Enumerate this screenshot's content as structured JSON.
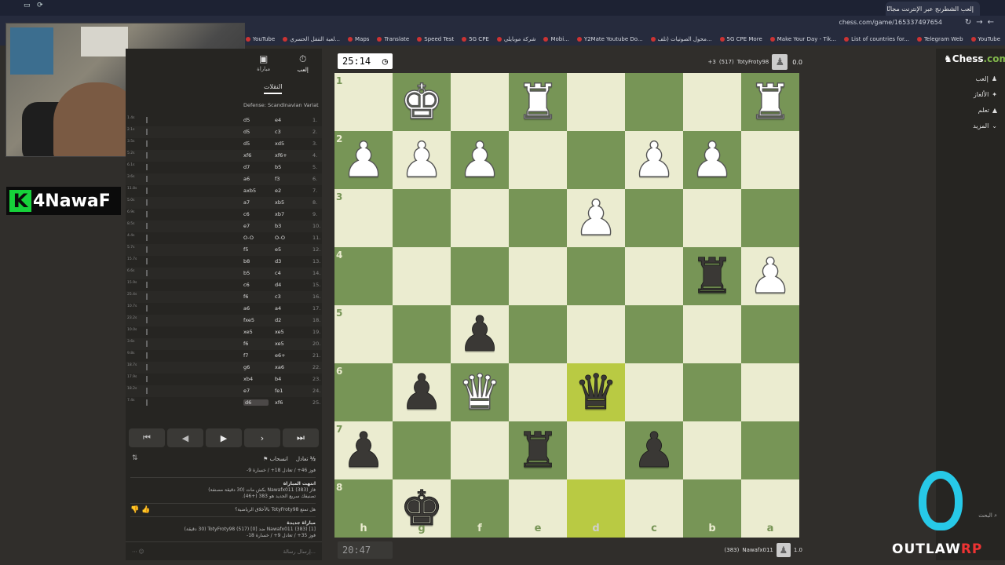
{
  "browser": {
    "tab_title": "إلعب الشطرنج عبر الإنترنت مجانًا",
    "url": "chess.com/game/165337497654",
    "bookmarks": [
      "التطبيقات",
      "Gmail",
      "YouTube",
      "لعبة التنقل الحسري...",
      "Maps",
      "Translate",
      "Speed Test",
      "5G CPE",
      "شركة موبايلي",
      "Mobi...",
      "Y2Mate Youtube Do...",
      "محول الصوتيات (تلف...",
      "5G CPE More",
      "Make Your Day - Tik...",
      "List of countries for...",
      "Telegram Web",
      "YouTube"
    ]
  },
  "stream": {
    "brand": "4NawaF",
    "brand_k": "K"
  },
  "left_panel": {
    "tab_play": "إلعب",
    "tab_game": "مباراة",
    "moves_tab": "النقلات",
    "opening": "Defense: Scandinavian Variation",
    "moves": [
      {
        "n": "1.",
        "w": "e4",
        "b": "d5",
        "t": "1.4s"
      },
      {
        "n": "2.",
        "w": "c3",
        "b": "d5",
        "t": "2.1s"
      },
      {
        "n": "3.",
        "w": "xd5",
        "b": "d5",
        "t": "3.5s"
      },
      {
        "n": "4.",
        "w": "xf6+",
        "b": "xf6",
        "t": "5.2s"
      },
      {
        "n": "5.",
        "w": "b5",
        "b": "d7",
        "t": "6.1s"
      },
      {
        "n": "6.",
        "w": "f3",
        "b": "a6",
        "t": "3.6s"
      },
      {
        "n": "7.",
        "w": "e2",
        "b": "axb5",
        "t": "11.8s"
      },
      {
        "n": "8.",
        "w": "xb5",
        "b": "a7",
        "t": "5.0s"
      },
      {
        "n": "9.",
        "w": "xb7",
        "b": "c6",
        "t": "6.9s"
      },
      {
        "n": "10.",
        "w": "b3",
        "b": "e7",
        "t": "8.5s"
      },
      {
        "n": "11.",
        "w": "O-O",
        "b": "O-O",
        "t": "4.4s"
      },
      {
        "n": "12.",
        "w": "e5",
        "b": "f5",
        "t": "5.7s"
      },
      {
        "n": "13.",
        "w": "d3",
        "b": "b8",
        "t": "15.7s"
      },
      {
        "n": "14.",
        "w": "c4",
        "b": "b5",
        "t": "6.6s"
      },
      {
        "n": "15.",
        "w": "d4",
        "b": "c6",
        "t": "15.9s"
      },
      {
        "n": "16.",
        "w": "c3",
        "b": "f6",
        "t": "25.4s"
      },
      {
        "n": "17.",
        "w": "a4",
        "b": "a6",
        "t": "10.7s"
      },
      {
        "n": "18.",
        "w": "d2",
        "b": "fxe5",
        "t": "23.2s"
      },
      {
        "n": "19.",
        "w": "xe5",
        "b": "xe5",
        "t": "10.0s"
      },
      {
        "n": "20.",
        "w": "xe5",
        "b": "f6",
        "t": "3.6s"
      },
      {
        "n": "21.",
        "w": "e6+",
        "b": "f7",
        "t": "9.8s"
      },
      {
        "n": "22.",
        "w": "xa6",
        "b": "g6",
        "t": "18.7s"
      },
      {
        "n": "23.",
        "w": "b4",
        "b": "xb4",
        "t": "17.9s"
      },
      {
        "n": "24.",
        "w": "fe1",
        "b": "e7",
        "t": "18.2s"
      },
      {
        "n": "25.",
        "w": "xf6",
        "b": "d6",
        "t": "7.4s"
      }
    ],
    "actions": {
      "draw": "تعادل",
      "resign": "انسحاب",
      "half": "½"
    },
    "log": {
      "stats1": "فوز 46+ / تعادل 18+ / خسارة 9-",
      "ended": "انتهت المباراة",
      "result_line": "فاز Nawafx011 (383) بكش مات (30 دقيقة مصنفة)",
      "rating_line": "تصنيفك سريع الجديد هو 383 (+46).",
      "sportsmanship": "هل تمتع TotyFroty98 بالأخلاق الرياضية؟",
      "new_match": "مباراة جديدة",
      "new_match_line": "Nawafx011 (383) [1] ضد TotyFroty98 (517) [0] (30 دقيقة)",
      "stats2": "فوز 35+ / تعادل 9+ / خسارة 18-"
    },
    "chat_placeholder": "إرسال رسالة..."
  },
  "game": {
    "clock_top": "25:14",
    "clock_bottom": "20:47",
    "top_player": {
      "name": "TotyFroty98",
      "rating": "(517)",
      "score": "0.0",
      "extra": "+3"
    },
    "bottom_player": {
      "name": "Nawafx011",
      "rating": "(383)",
      "score": "1.0"
    },
    "ranks": [
      "1",
      "2",
      "3",
      "4",
      "5",
      "6",
      "7",
      "8"
    ],
    "files": [
      "h",
      "g",
      "f",
      "e",
      "d",
      "c",
      "b",
      "a"
    ],
    "board": [
      [
        "",
        "wK",
        "",
        "wR",
        "",
        "",
        "",
        "wR"
      ],
      [
        "wP",
        "wP",
        "wP",
        "",
        "",
        "wP",
        "wP",
        ""
      ],
      [
        "",
        "",
        "",
        "",
        "wP",
        "",
        "",
        ""
      ],
      [
        "",
        "",
        "",
        "",
        "",
        "",
        "bR",
        "wP"
      ],
      [
        "",
        "",
        "bP",
        "",
        "",
        "",
        "",
        ""
      ],
      [
        "",
        "bP",
        "wQ",
        "",
        "bQ",
        "",
        "",
        ""
      ],
      [
        "bP",
        "",
        "",
        "bR",
        "",
        "bP",
        "",
        ""
      ],
      [
        "",
        "bK",
        "",
        "",
        "",
        "",
        "",
        ""
      ]
    ]
  },
  "right_nav": {
    "logo_a": "Chess",
    "logo_b": ".com",
    "items": [
      "إلعب",
      "الألغاز",
      "تعلم",
      "المزيد"
    ],
    "search": "البحث"
  },
  "watermark": {
    "name": "OUTLAW",
    "suffix": "RP"
  }
}
